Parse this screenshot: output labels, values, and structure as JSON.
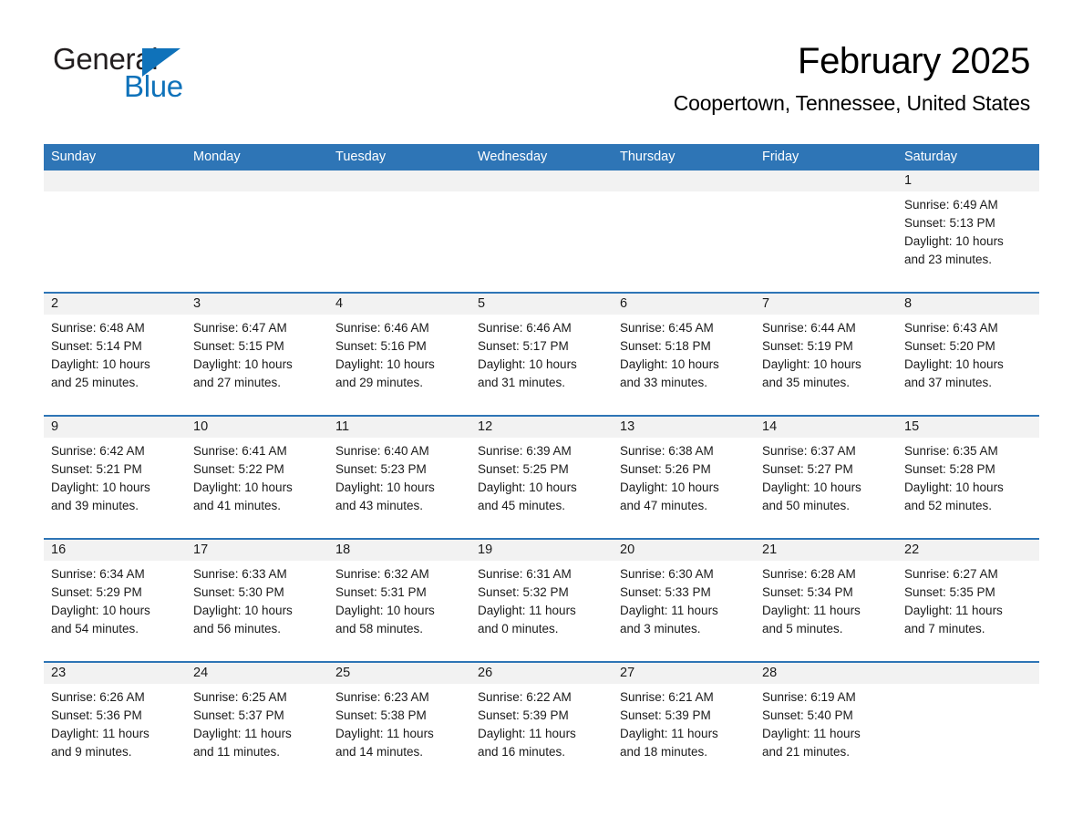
{
  "brand": {
    "word_one": "General",
    "word_two": "Blue",
    "triangle_icon": "blue-triangle-icon",
    "accent_color": "#0f72ba"
  },
  "header": {
    "title": "February 2025",
    "subtitle": "Coopertown, Tennessee, United States"
  },
  "theme": {
    "header_blue": "#2e75b6",
    "daynum_band": "#f2f2f2",
    "text": "#1a1a1a"
  },
  "weekdays": [
    "Sunday",
    "Monday",
    "Tuesday",
    "Wednesday",
    "Thursday",
    "Friday",
    "Saturday"
  ],
  "weeks": [
    [
      {
        "day": "",
        "sunrise": "",
        "sunset": "",
        "daylight_1": "",
        "daylight_2": ""
      },
      {
        "day": "",
        "sunrise": "",
        "sunset": "",
        "daylight_1": "",
        "daylight_2": ""
      },
      {
        "day": "",
        "sunrise": "",
        "sunset": "",
        "daylight_1": "",
        "daylight_2": ""
      },
      {
        "day": "",
        "sunrise": "",
        "sunset": "",
        "daylight_1": "",
        "daylight_2": ""
      },
      {
        "day": "",
        "sunrise": "",
        "sunset": "",
        "daylight_1": "",
        "daylight_2": ""
      },
      {
        "day": "",
        "sunrise": "",
        "sunset": "",
        "daylight_1": "",
        "daylight_2": ""
      },
      {
        "day": "1",
        "sunrise": "Sunrise: 6:49 AM",
        "sunset": "Sunset: 5:13 PM",
        "daylight_1": "Daylight: 10 hours",
        "daylight_2": "and 23 minutes."
      }
    ],
    [
      {
        "day": "2",
        "sunrise": "Sunrise: 6:48 AM",
        "sunset": "Sunset: 5:14 PM",
        "daylight_1": "Daylight: 10 hours",
        "daylight_2": "and 25 minutes."
      },
      {
        "day": "3",
        "sunrise": "Sunrise: 6:47 AM",
        "sunset": "Sunset: 5:15 PM",
        "daylight_1": "Daylight: 10 hours",
        "daylight_2": "and 27 minutes."
      },
      {
        "day": "4",
        "sunrise": "Sunrise: 6:46 AM",
        "sunset": "Sunset: 5:16 PM",
        "daylight_1": "Daylight: 10 hours",
        "daylight_2": "and 29 minutes."
      },
      {
        "day": "5",
        "sunrise": "Sunrise: 6:46 AM",
        "sunset": "Sunset: 5:17 PM",
        "daylight_1": "Daylight: 10 hours",
        "daylight_2": "and 31 minutes."
      },
      {
        "day": "6",
        "sunrise": "Sunrise: 6:45 AM",
        "sunset": "Sunset: 5:18 PM",
        "daylight_1": "Daylight: 10 hours",
        "daylight_2": "and 33 minutes."
      },
      {
        "day": "7",
        "sunrise": "Sunrise: 6:44 AM",
        "sunset": "Sunset: 5:19 PM",
        "daylight_1": "Daylight: 10 hours",
        "daylight_2": "and 35 minutes."
      },
      {
        "day": "8",
        "sunrise": "Sunrise: 6:43 AM",
        "sunset": "Sunset: 5:20 PM",
        "daylight_1": "Daylight: 10 hours",
        "daylight_2": "and 37 minutes."
      }
    ],
    [
      {
        "day": "9",
        "sunrise": "Sunrise: 6:42 AM",
        "sunset": "Sunset: 5:21 PM",
        "daylight_1": "Daylight: 10 hours",
        "daylight_2": "and 39 minutes."
      },
      {
        "day": "10",
        "sunrise": "Sunrise: 6:41 AM",
        "sunset": "Sunset: 5:22 PM",
        "daylight_1": "Daylight: 10 hours",
        "daylight_2": "and 41 minutes."
      },
      {
        "day": "11",
        "sunrise": "Sunrise: 6:40 AM",
        "sunset": "Sunset: 5:23 PM",
        "daylight_1": "Daylight: 10 hours",
        "daylight_2": "and 43 minutes."
      },
      {
        "day": "12",
        "sunrise": "Sunrise: 6:39 AM",
        "sunset": "Sunset: 5:25 PM",
        "daylight_1": "Daylight: 10 hours",
        "daylight_2": "and 45 minutes."
      },
      {
        "day": "13",
        "sunrise": "Sunrise: 6:38 AM",
        "sunset": "Sunset: 5:26 PM",
        "daylight_1": "Daylight: 10 hours",
        "daylight_2": "and 47 minutes."
      },
      {
        "day": "14",
        "sunrise": "Sunrise: 6:37 AM",
        "sunset": "Sunset: 5:27 PM",
        "daylight_1": "Daylight: 10 hours",
        "daylight_2": "and 50 minutes."
      },
      {
        "day": "15",
        "sunrise": "Sunrise: 6:35 AM",
        "sunset": "Sunset: 5:28 PM",
        "daylight_1": "Daylight: 10 hours",
        "daylight_2": "and 52 minutes."
      }
    ],
    [
      {
        "day": "16",
        "sunrise": "Sunrise: 6:34 AM",
        "sunset": "Sunset: 5:29 PM",
        "daylight_1": "Daylight: 10 hours",
        "daylight_2": "and 54 minutes."
      },
      {
        "day": "17",
        "sunrise": "Sunrise: 6:33 AM",
        "sunset": "Sunset: 5:30 PM",
        "daylight_1": "Daylight: 10 hours",
        "daylight_2": "and 56 minutes."
      },
      {
        "day": "18",
        "sunrise": "Sunrise: 6:32 AM",
        "sunset": "Sunset: 5:31 PM",
        "daylight_1": "Daylight: 10 hours",
        "daylight_2": "and 58 minutes."
      },
      {
        "day": "19",
        "sunrise": "Sunrise: 6:31 AM",
        "sunset": "Sunset: 5:32 PM",
        "daylight_1": "Daylight: 11 hours",
        "daylight_2": "and 0 minutes."
      },
      {
        "day": "20",
        "sunrise": "Sunrise: 6:30 AM",
        "sunset": "Sunset: 5:33 PM",
        "daylight_1": "Daylight: 11 hours",
        "daylight_2": "and 3 minutes."
      },
      {
        "day": "21",
        "sunrise": "Sunrise: 6:28 AM",
        "sunset": "Sunset: 5:34 PM",
        "daylight_1": "Daylight: 11 hours",
        "daylight_2": "and 5 minutes."
      },
      {
        "day": "22",
        "sunrise": "Sunrise: 6:27 AM",
        "sunset": "Sunset: 5:35 PM",
        "daylight_1": "Daylight: 11 hours",
        "daylight_2": "and 7 minutes."
      }
    ],
    [
      {
        "day": "23",
        "sunrise": "Sunrise: 6:26 AM",
        "sunset": "Sunset: 5:36 PM",
        "daylight_1": "Daylight: 11 hours",
        "daylight_2": "and 9 minutes."
      },
      {
        "day": "24",
        "sunrise": "Sunrise: 6:25 AM",
        "sunset": "Sunset: 5:37 PM",
        "daylight_1": "Daylight: 11 hours",
        "daylight_2": "and 11 minutes."
      },
      {
        "day": "25",
        "sunrise": "Sunrise: 6:23 AM",
        "sunset": "Sunset: 5:38 PM",
        "daylight_1": "Daylight: 11 hours",
        "daylight_2": "and 14 minutes."
      },
      {
        "day": "26",
        "sunrise": "Sunrise: 6:22 AM",
        "sunset": "Sunset: 5:39 PM",
        "daylight_1": "Daylight: 11 hours",
        "daylight_2": "and 16 minutes."
      },
      {
        "day": "27",
        "sunrise": "Sunrise: 6:21 AM",
        "sunset": "Sunset: 5:39 PM",
        "daylight_1": "Daylight: 11 hours",
        "daylight_2": "and 18 minutes."
      },
      {
        "day": "28",
        "sunrise": "Sunrise: 6:19 AM",
        "sunset": "Sunset: 5:40 PM",
        "daylight_1": "Daylight: 11 hours",
        "daylight_2": "and 21 minutes."
      },
      {
        "day": "",
        "sunrise": "",
        "sunset": "",
        "daylight_1": "",
        "daylight_2": ""
      }
    ]
  ]
}
